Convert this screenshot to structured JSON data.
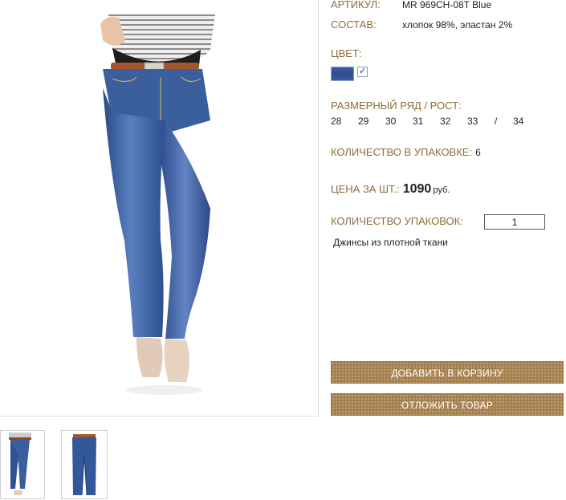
{
  "product": {
    "article_label": "АРТИКУЛ:",
    "article_value": "MR 969CH-08T Blue",
    "composition_label": "СОСТАВ:",
    "composition_value": "хлопок 98%, эластан 2%",
    "color_label": "ЦВЕТ:",
    "color_swatch": "#34559a",
    "color_checked": "✓",
    "sizes_label": "РАЗМЕРНЫЙ РЯД / РОСТ:",
    "sizes": [
      "28",
      "29",
      "30",
      "31",
      "32",
      "33",
      "/",
      "34"
    ],
    "pack_label": "КОЛИЧЕСТВО В УПАКОВКЕ:",
    "pack_value": "6",
    "price_label": "ЦЕНА ЗА ШТ.:",
    "price_value": "1090",
    "price_currency": "руб.",
    "qty_label": "КОЛИЧЕСТВО УПАКОВОК:",
    "qty_value": "1",
    "description": "Джинсы из плотной ткани"
  },
  "buttons": {
    "add_to_cart": "ДОБАВИТЬ В КОРЗИНУ",
    "defer": "ОТЛОЖИТЬ ТОВАР"
  },
  "images": {
    "main": "jeans-model-front-photo",
    "thumbnails": [
      "jeans-model-side-thumbnail",
      "jeans-flat-thumbnail"
    ]
  },
  "colors": {
    "label_accent": "#8b6d3a",
    "button_brown": "#a57f4e",
    "denim": "#3a5f9c"
  }
}
